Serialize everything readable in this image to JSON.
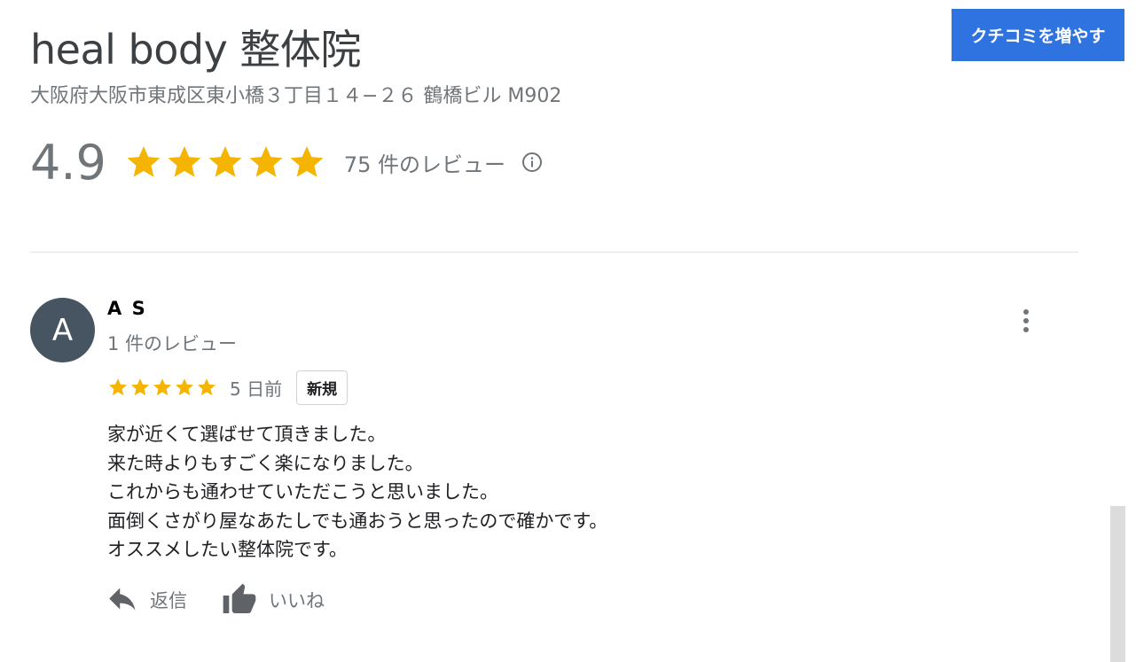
{
  "business": {
    "title": "heal body 整体院",
    "address": "大阪府大阪市東成区東小橋３丁目１４−２６ 鶴橋ビル M902",
    "rating": "4.9",
    "stars": 5,
    "review_count_label": "75 件のレビュー"
  },
  "header": {
    "add_review_label": "クチコミを増やす",
    "accent_color": "#2f73e1"
  },
  "colors": {
    "star": "#f4b400",
    "avatar_bg": "#465561"
  },
  "icons": {
    "info": "info-icon",
    "more": "more-vert-icon",
    "reply": "reply-icon",
    "like": "thumb-up-icon"
  },
  "review": {
    "avatar_letter": "A",
    "author": "A S",
    "author_meta": "1 件のレビュー",
    "stars": 5,
    "date": "5 日前",
    "badge": "新規",
    "lines": [
      "家が近くて選ばせて頂きました。",
      "来た時よりもすごく楽になりました。",
      "これからも通わせていただこうと思いました。",
      "面倒くさがり屋なあたしでも通おうと思ったので確かです。",
      "オススメしたい整体院です。"
    ],
    "reply_label": "返信",
    "like_label": "いいね"
  }
}
